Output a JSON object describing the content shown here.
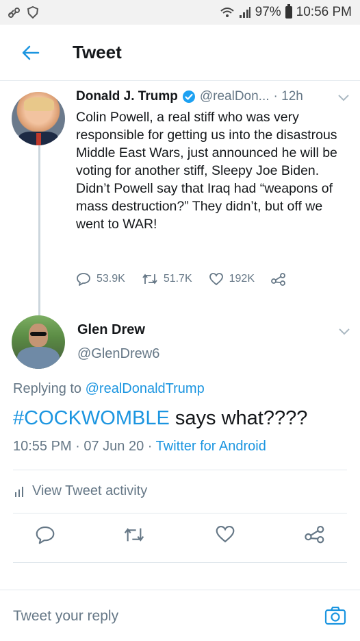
{
  "status_bar": {
    "battery": "97%",
    "time": "10:56 PM"
  },
  "header": {
    "title": "Tweet"
  },
  "tweet1": {
    "name": "Donald J. Trump",
    "handle": "@realDon...",
    "age": "· 12h",
    "text": "Colin Powell, a real stiff who was very responsible for getting us into the disastrous Middle East Wars, just announced he will be voting for another stiff, Sleepy Joe Biden. Didn’t Powell say that Iraq had “weapons of mass destruction?” They didn’t, but off we went to WAR!",
    "replies": "53.9K",
    "retweets": "51.7K",
    "likes": "192K"
  },
  "tweet2": {
    "name": "Glen Drew",
    "handle": "@GlenDrew6",
    "replying_prefix": "Replying to",
    "replying_to": "@realDonaldTrump",
    "hashtag": "#COCKWOMBLE",
    "text": " says what????",
    "timestamp": "10:55 PM · 07 Jun 20 · ",
    "source": "Twitter for Android"
  },
  "activity": {
    "label": "View Tweet activity"
  },
  "reply_bar": {
    "placeholder": "Tweet your reply"
  },
  "colors": {
    "accent": "#1b95e0",
    "muted": "#657786",
    "text": "#14171a",
    "divider": "#e1e8ed"
  },
  "icons": [
    "wifi-icon",
    "signal-icon",
    "battery-icon",
    "back-arrow-icon",
    "verified-badge-icon",
    "chevron-down-icon",
    "reply-icon",
    "retweet-icon",
    "like-icon",
    "share-icon",
    "activity-bars-icon",
    "camera-icon"
  ]
}
